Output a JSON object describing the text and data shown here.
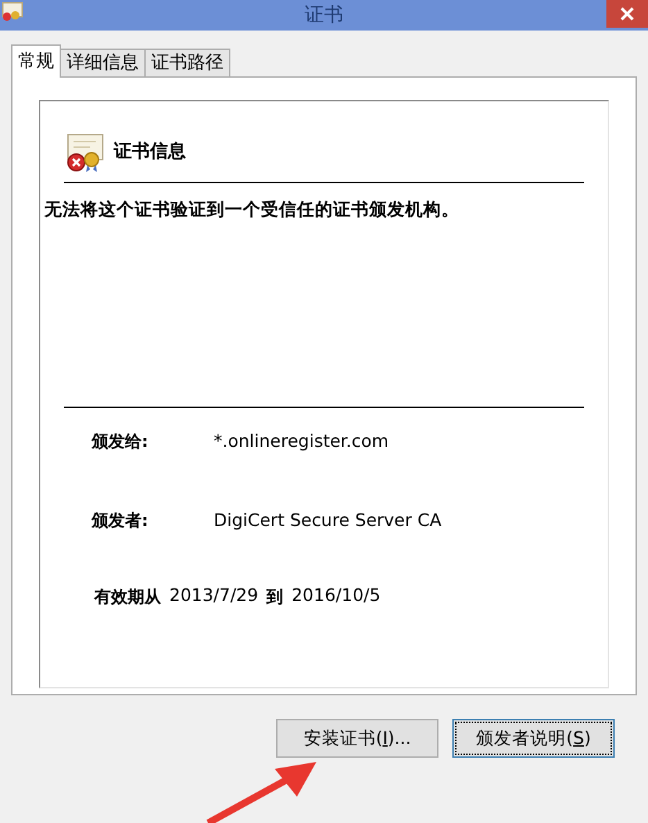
{
  "window": {
    "title": "证书"
  },
  "tabs": [
    {
      "label": "常规",
      "selected": true
    },
    {
      "label": "详细信息",
      "selected": false
    },
    {
      "label": "证书路径",
      "selected": false
    }
  ],
  "info": {
    "heading": "证书信息",
    "error": true,
    "message": "无法将这个证书验证到一个受信任的证书颁发机构。",
    "fields": [
      {
        "label": "颁发给:",
        "value": "*.onlineregister.com"
      },
      {
        "label": "颁发者:",
        "value": "DigiCert Secure Server CA"
      }
    ],
    "validity": {
      "label": "有效期从",
      "from": "2013/7/29",
      "to_label": "到",
      "to": "2016/10/5"
    }
  },
  "buttons": [
    {
      "before": "安装证书(",
      "key": "I",
      "after": ")...",
      "focused": false
    },
    {
      "before": "颁发者说明(",
      "key": "S",
      "after": ")",
      "focused": true
    }
  ]
}
